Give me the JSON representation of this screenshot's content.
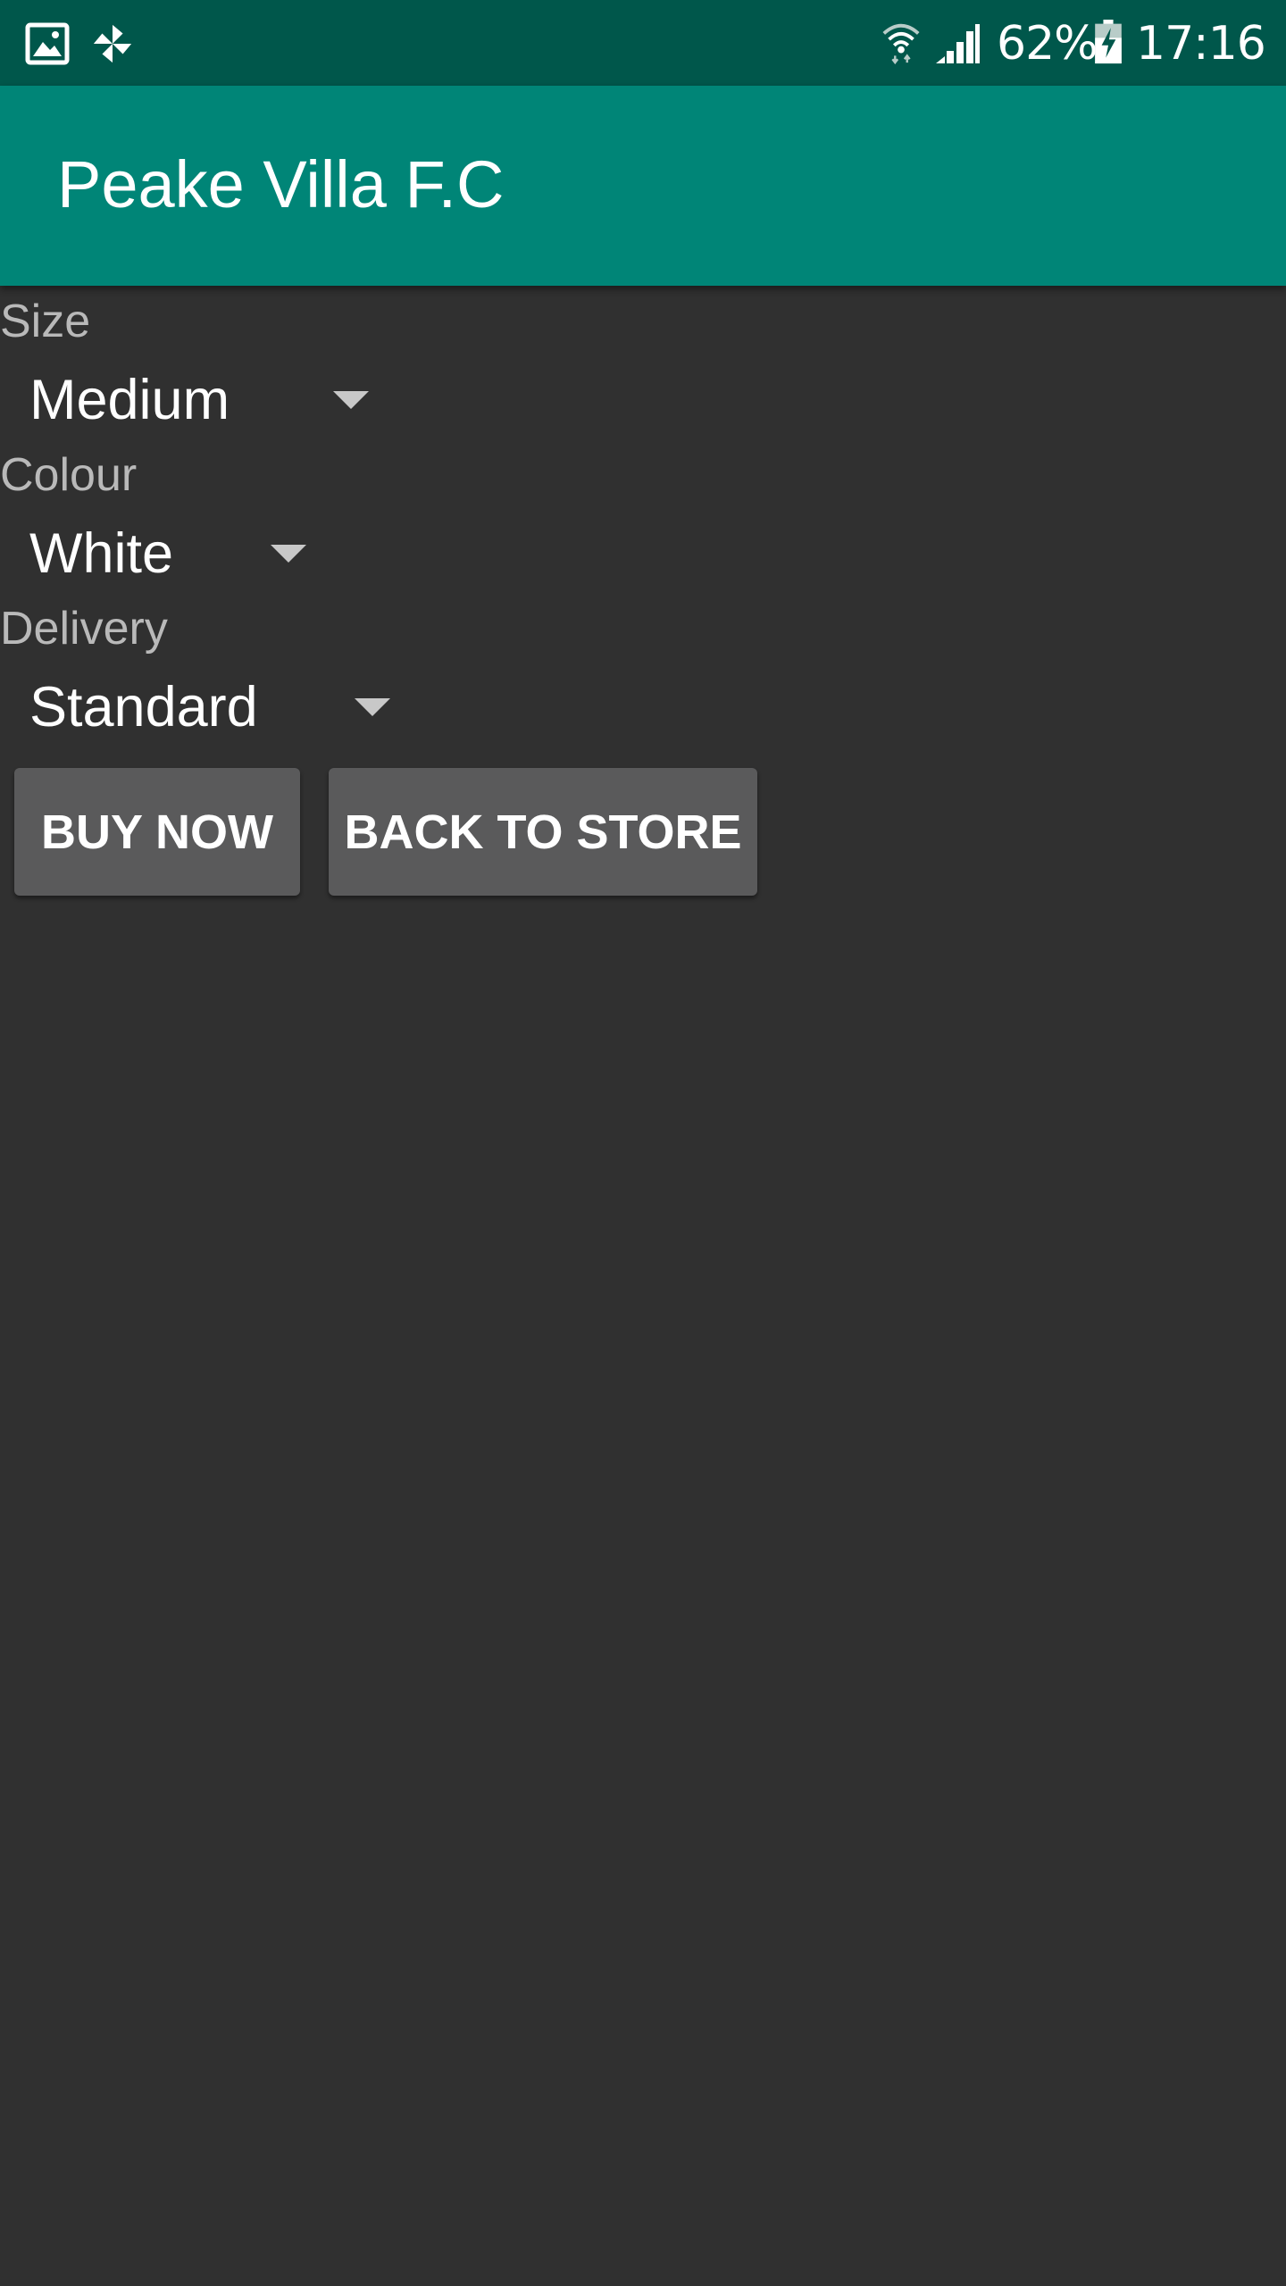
{
  "status_bar": {
    "notification_icons": [
      "gallery-icon",
      "pinwheel-icon"
    ],
    "wifi_icon": "wifi-icon",
    "signal_icon": "cell-signal-icon",
    "battery_percent": "62%",
    "battery_icon": "battery-charging-icon",
    "time": "17:16"
  },
  "app_bar": {
    "title": "Peake Villa F.C"
  },
  "form": {
    "size": {
      "label": "Size",
      "value": "Medium"
    },
    "colour": {
      "label": "Colour",
      "value": "White"
    },
    "delivery": {
      "label": "Delivery",
      "value": "Standard"
    }
  },
  "buttons": {
    "buy_now": "BUY NOW",
    "back_to_store": "BACK TO STORE"
  },
  "colors": {
    "status_bar": "#00574b",
    "primary": "#008577",
    "background": "#303030",
    "button": "#5a5a5b"
  }
}
